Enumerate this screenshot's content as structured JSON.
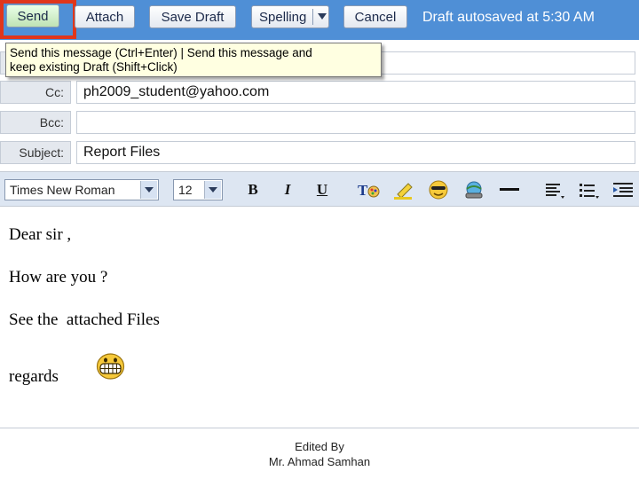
{
  "toolbar": {
    "send_label": "Send",
    "attach_label": "Attach",
    "save_draft_label": "Save Draft",
    "spelling_label": "Spelling",
    "cancel_label": "Cancel",
    "autosave_status": "Draft autosaved at 5:30 AM",
    "highlight_color": "#e0361b",
    "background_color": "#4f8fd6"
  },
  "tooltip": {
    "line1": "Send this message (Ctrl+Enter) | Send this message and",
    "line2": "keep existing Draft (Shift+Click)"
  },
  "header": {
    "cc_label": "Cc:",
    "cc_value": "ph2009_student@yahoo.com",
    "bcc_label": "Bcc:",
    "bcc_value": "",
    "subject_label": "Subject:",
    "subject_value": "Report Files"
  },
  "formatting": {
    "font_family": "Times New Roman",
    "font_size": "12",
    "bold_glyph": "B",
    "italic_glyph": "I",
    "underline_glyph": "U",
    "icons": [
      "font-color-icon",
      "highlight-icon",
      "emoticon-icon",
      "insert-image-icon",
      "horizontal-rule-icon",
      "align-icon",
      "list-icon",
      "indent-icon"
    ]
  },
  "message": {
    "line1": "Dear sir ,",
    "line2": "How are you ?",
    "line3": "See the  attached Files",
    "line4": "regards",
    "emoticon": "grin-smiley-icon"
  },
  "credit": {
    "line1": "Edited By",
    "line2": "Mr. Ahmad Samhan"
  }
}
